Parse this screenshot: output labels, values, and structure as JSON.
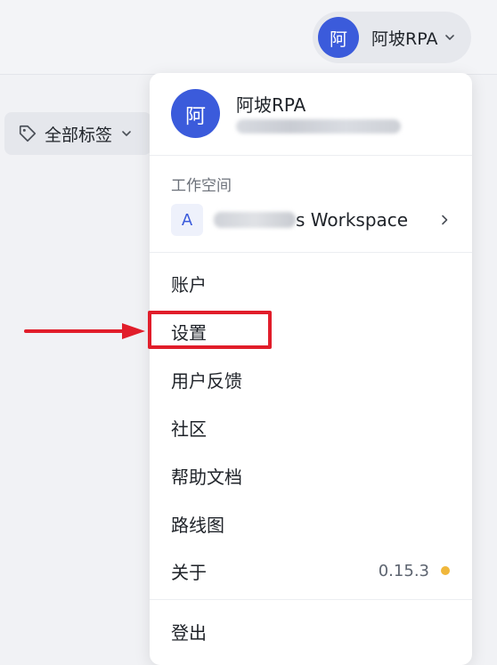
{
  "header": {
    "user_avatar_char": "阿",
    "user_name": "阿坡RPA"
  },
  "filter": {
    "tag_label": "全部标签"
  },
  "menu": {
    "avatar_char": "阿",
    "user_name": "阿坡RPA",
    "workspace_section": "工作空间",
    "workspace_badge": "A",
    "workspace_name": "s Workspace",
    "items": [
      {
        "label": "账户"
      },
      {
        "label": "设置"
      },
      {
        "label": "用户反馈"
      },
      {
        "label": "社区"
      },
      {
        "label": "帮助文档"
      },
      {
        "label": "路线图"
      },
      {
        "label": "关于",
        "version": "0.15.3"
      }
    ],
    "logout": "登出"
  },
  "colors": {
    "accent": "#3b5bdb",
    "highlight": "#e11d2a",
    "status_dot": "#f0b73b"
  },
  "icons": [
    "chevron-down-icon",
    "tag-icon",
    "chevron-right-icon",
    "arrow-right-icon"
  ]
}
